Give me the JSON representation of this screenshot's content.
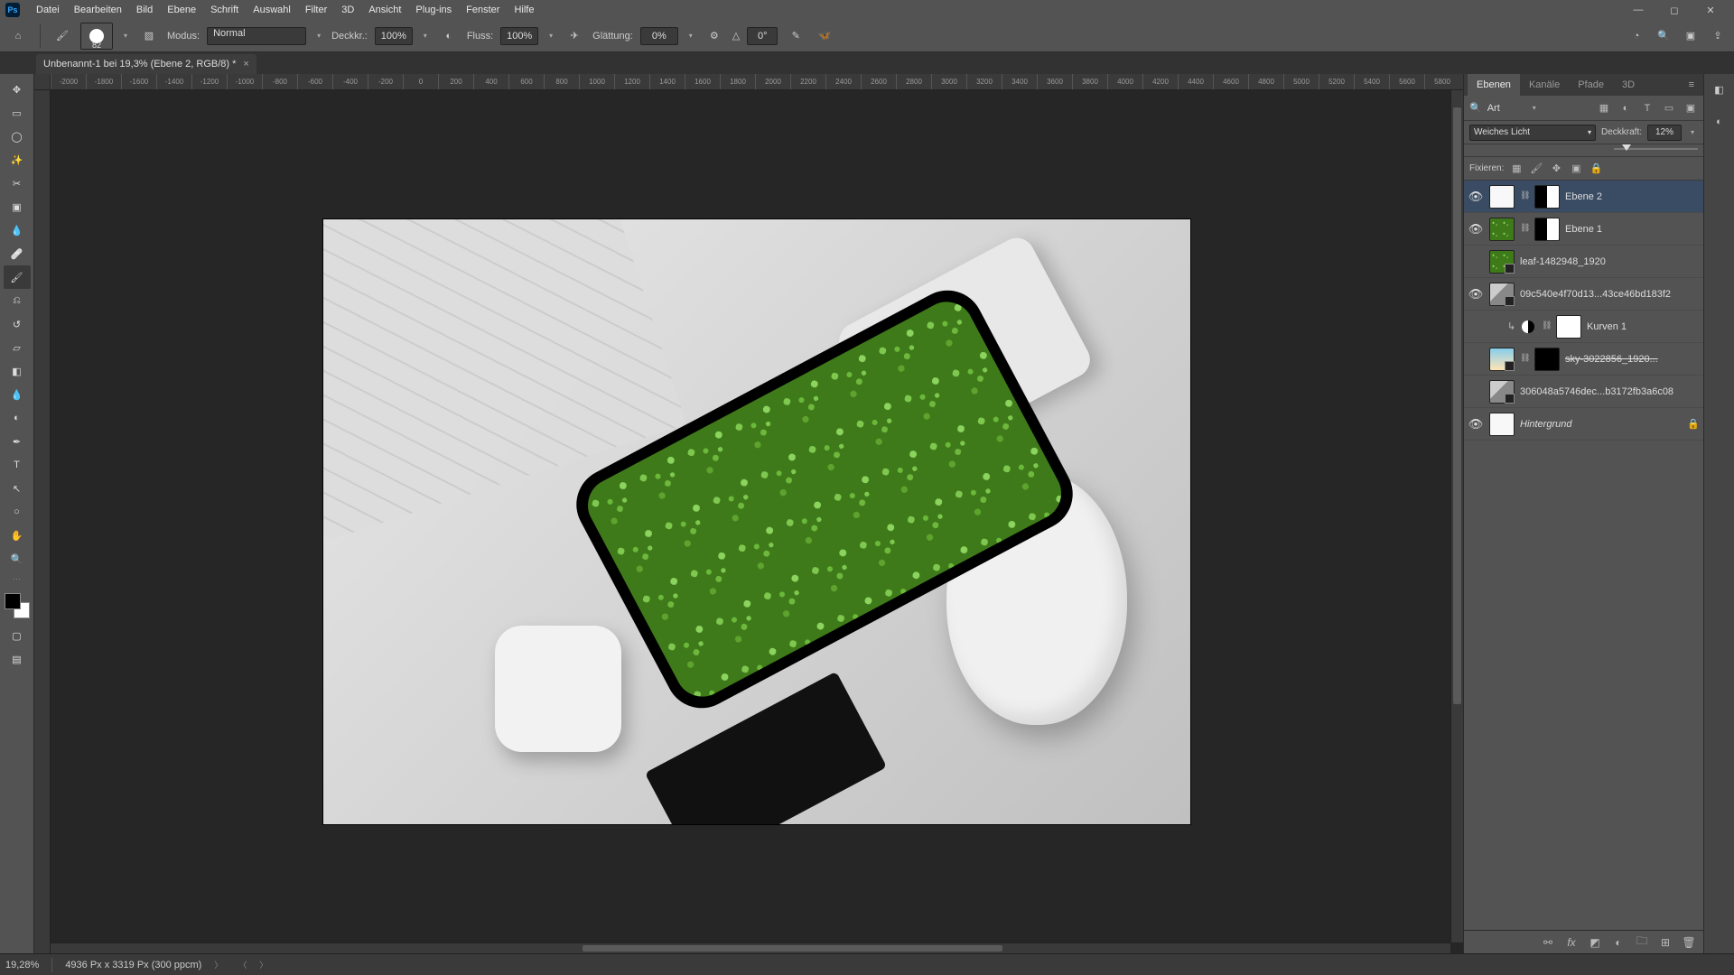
{
  "menu": {
    "items": [
      "Datei",
      "Bearbeiten",
      "Bild",
      "Ebene",
      "Schrift",
      "Auswahl",
      "Filter",
      "3D",
      "Ansicht",
      "Plug-ins",
      "Fenster",
      "Hilfe"
    ]
  },
  "options": {
    "brush_size": "82",
    "mode_label": "Modus:",
    "mode_value": "Normal",
    "opacity_label": "Deckkr.:",
    "opacity_value": "100%",
    "flow_label": "Fluss:",
    "flow_value": "100%",
    "smoothing_label": "Glättung:",
    "smoothing_value": "0%",
    "angle_label": "△",
    "angle_value": "0°"
  },
  "doc_tab": {
    "title": "Unbenannt-1 bei 19,3% (Ebene 2, RGB/8) *"
  },
  "ruler_h": [
    "-2000",
    "-1800",
    "-1600",
    "-1400",
    "-1200",
    "-1000",
    "-800",
    "-600",
    "-400",
    "-200",
    "0",
    "200",
    "400",
    "600",
    "800",
    "1000",
    "1200",
    "1400",
    "1600",
    "1800",
    "2000",
    "2200",
    "2400",
    "2600",
    "2800",
    "3000",
    "3200",
    "3400",
    "3600",
    "3800",
    "4000",
    "4200",
    "4400",
    "4600",
    "4800",
    "5000",
    "5200",
    "5400",
    "5600",
    "5800"
  ],
  "panel": {
    "tabs": {
      "ebenen": "Ebenen",
      "kanaele": "Kanäle",
      "pfade": "Pfade",
      "dreid": "3D"
    },
    "search_placeholder": "Art",
    "blend_mode": "Weiches Licht",
    "opacity_label": "Deckkraft:",
    "opacity_value": "12%",
    "lock_label": "Fixieren:"
  },
  "layers": [
    {
      "visible": true,
      "thumb": "white",
      "linked": true,
      "mask": "black-white",
      "name": "Ebene 2",
      "selected": true
    },
    {
      "visible": true,
      "thumb": "green",
      "linked": true,
      "mask": "black-white",
      "name": "Ebene 1"
    },
    {
      "visible": false,
      "thumb": "green",
      "smart": true,
      "name": "leaf-1482948_1920"
    },
    {
      "visible": true,
      "thumb": "photo",
      "smart": true,
      "name": "09c540e4f70d13...43ce46bd183f2"
    },
    {
      "visible": false,
      "adj": true,
      "linked": true,
      "mask": "white",
      "name": "Kurven 1",
      "indent": true
    },
    {
      "visible": false,
      "thumb": "sky",
      "smart": true,
      "linked": true,
      "mask": "black",
      "name": "sky-3022856_1920...",
      "strike": true
    },
    {
      "visible": false,
      "thumb": "photo",
      "smart": true,
      "name": "306048a5746dec...b3172fb3a6c08"
    },
    {
      "visible": true,
      "thumb": "white",
      "name": "Hintergrund",
      "italic": true,
      "locked": true
    }
  ],
  "status": {
    "zoom": "19,28%",
    "doc_info": "4936 Px x 3319 Px (300 ppcm)"
  }
}
